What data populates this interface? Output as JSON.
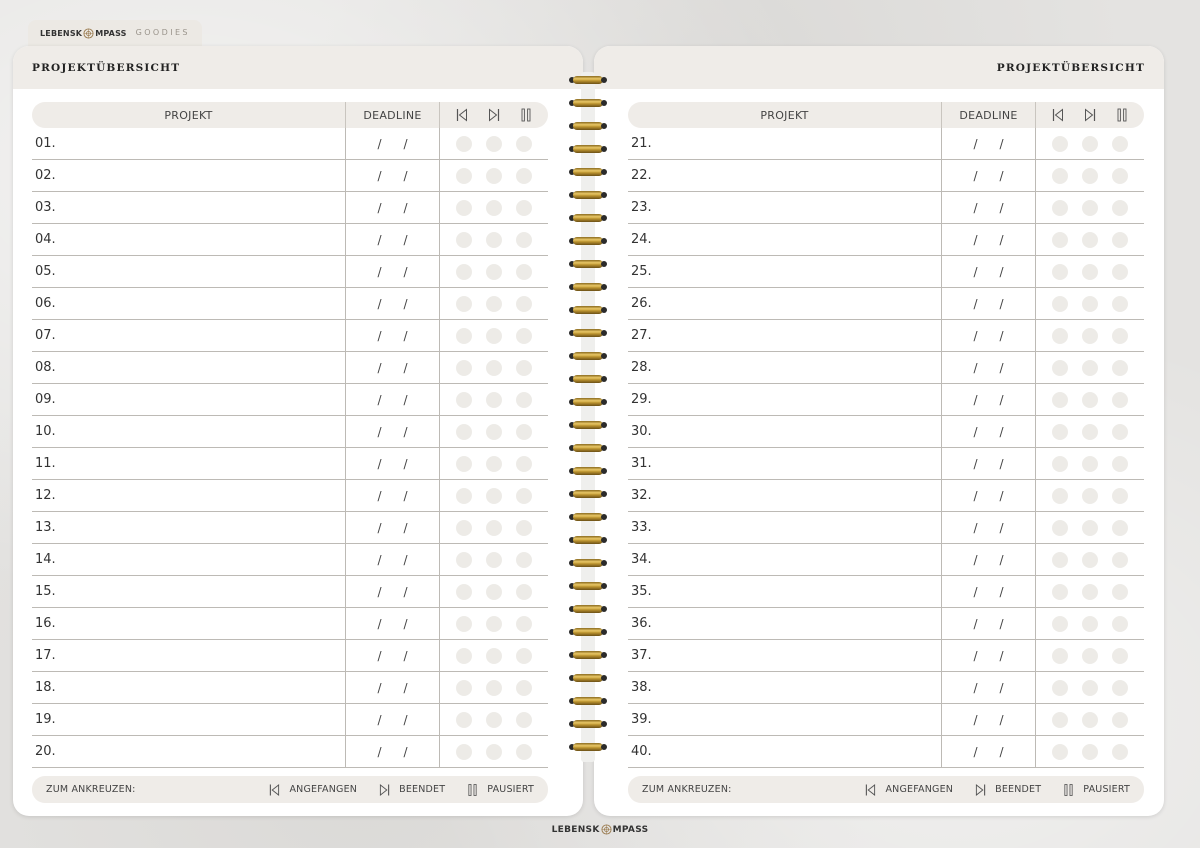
{
  "brand": {
    "text_a": "LEBENSK",
    "text_b": "MPASS",
    "goodies": "GOODIES"
  },
  "left_page": {
    "title": "PROJEKTÜBERSICHT",
    "headers": {
      "projekt": "PROJEKT",
      "deadline": "DEADLINE"
    },
    "rows": [
      "01.",
      "02.",
      "03.",
      "04.",
      "05.",
      "06.",
      "07.",
      "08.",
      "09.",
      "10.",
      "11.",
      "12.",
      "13.",
      "14.",
      "15.",
      "16.",
      "17.",
      "18.",
      "19.",
      "20."
    ],
    "footer": {
      "label": "ZUM ANKREUZEN:",
      "started": "ANGEFANGEN",
      "finished": "BEENDET",
      "paused": "PAUSIERT"
    }
  },
  "right_page": {
    "title": "PROJEKTÜBERSICHT",
    "headers": {
      "projekt": "PROJEKT",
      "deadline": "DEADLINE"
    },
    "rows": [
      "21.",
      "22.",
      "23.",
      "24.",
      "25.",
      "26.",
      "27.",
      "28.",
      "29.",
      "30.",
      "31.",
      "32.",
      "33.",
      "34.",
      "35.",
      "36.",
      "37.",
      "38.",
      "39.",
      "40."
    ],
    "footer": {
      "label": "ZUM ANKREUZEN:",
      "started": "ANGEFANGEN",
      "finished": "BEENDET",
      "paused": "PAUSIERT"
    }
  },
  "deadline_separator": "/",
  "status_icons": [
    "angefangen-icon",
    "beendet-icon",
    "pausiert-icon"
  ],
  "colors": {
    "header_bg": "#efece8",
    "dot": "#edebe7",
    "wire_gold": "#d4af4f"
  }
}
